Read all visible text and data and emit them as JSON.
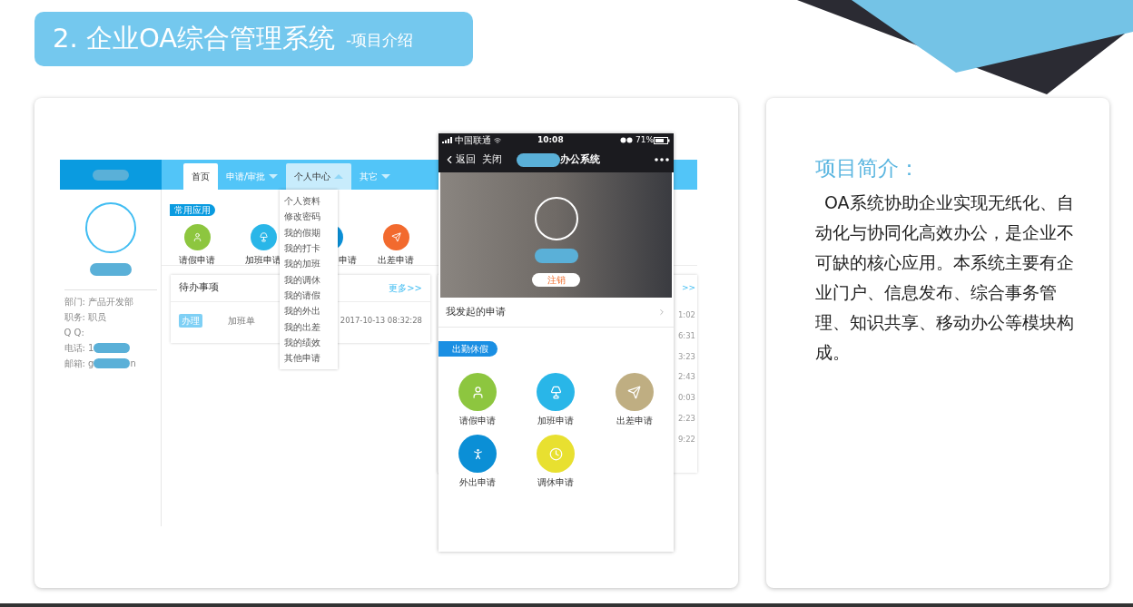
{
  "title": {
    "main": "2. 企业OA综合管理系统",
    "sub": "-项目介绍"
  },
  "web": {
    "nav": [
      {
        "label": "首页",
        "kind": "link",
        "selected": true
      },
      {
        "label": "申请/审批",
        "kind": "dropdown",
        "selected": false,
        "expanded": false
      },
      {
        "label": "个人中心",
        "kind": "dropdown",
        "selected": false,
        "expanded": true
      },
      {
        "label": "其它",
        "kind": "dropdown",
        "selected": false,
        "expanded": false
      }
    ],
    "dropdown": [
      "个人资料",
      "修改密码",
      "我的假期",
      "我的打卡",
      "我的加班",
      "我的调休",
      "我的请假",
      "我的外出",
      "我的出差",
      "我的绩效",
      "其他申请"
    ],
    "profile": [
      {
        "text": "部门: 产品开发部",
        "redacted": false
      },
      {
        "text": "职务: 职员",
        "redacted": false
      },
      {
        "text": "Q Q:",
        "redacted": false
      },
      {
        "text": "电话: 1",
        "redacted": true
      },
      {
        "text": "邮箱: g",
        "redacted": true,
        "tail": "n"
      }
    ],
    "apps_label": "常用应用",
    "apps": [
      {
        "label": "请假申请",
        "color": "#8dc63f",
        "kind": "user"
      },
      {
        "label": "加班申请",
        "color": "#29b6e8",
        "kind": "lamp"
      },
      {
        "label": "申请",
        "color": "#0b8fd6",
        "kind": "covered"
      },
      {
        "label": "出差申请",
        "color": "#f26a2e",
        "kind": "plane"
      }
    ],
    "todo": {
      "title": "待办事项",
      "more": "更多>>",
      "rows": [
        {
          "tag": "办理",
          "name": "加班单",
          "time": "2017-10-13 08:32:28"
        }
      ]
    },
    "side_card": {
      "more": ">>",
      "times": [
        "1:02",
        "6:31",
        "3:23",
        "2:43",
        "0:03",
        "2:23",
        "9:22"
      ]
    }
  },
  "phone": {
    "carrier": "中国联通",
    "time": "10:08",
    "battery": "71%",
    "back": "返回",
    "close": "关闭",
    "title": "办公系统",
    "logout": "注销",
    "row": "我发起的申请",
    "section": "出勤休假",
    "apps": [
      {
        "label": "请假申请",
        "color": "#8dc63f",
        "kind": "user"
      },
      {
        "label": "加班申请",
        "color": "#29b6e8",
        "kind": "lamp"
      },
      {
        "label": "出差申请",
        "color": "#bfae82",
        "kind": "plane"
      },
      {
        "label": "外出申请",
        "color": "#0b8fd6",
        "kind": "run"
      },
      {
        "label": "调休申请",
        "color": "#e8e030",
        "kind": "clock"
      }
    ]
  },
  "intro": {
    "heading": "项目简介：",
    "body": "OA系统协助企业实现无纸化、自动化与协同化高效办公，是企业不可缺的核心应用。本系统主要有企业门户、信息发布、综合事务管理、知识共享、移动办公等模块构成。"
  }
}
